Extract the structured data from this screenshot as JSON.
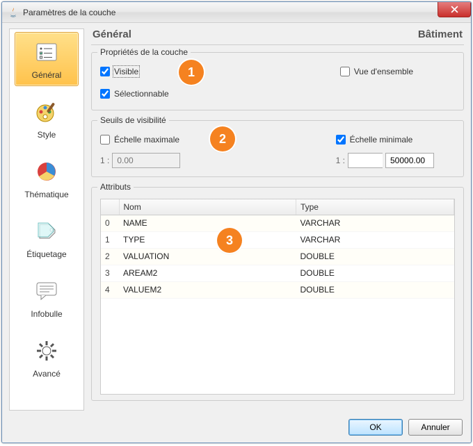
{
  "window": {
    "title": "Paramètres de la couche"
  },
  "sidebar": {
    "items": [
      {
        "label": "Général",
        "key": "general"
      },
      {
        "label": "Style",
        "key": "style"
      },
      {
        "label": "Thématique",
        "key": "theme"
      },
      {
        "label": "Étiquetage",
        "key": "label"
      },
      {
        "label": "Infobulle",
        "key": "tooltip"
      },
      {
        "label": "Avancé",
        "key": "advanced"
      }
    ]
  },
  "header": {
    "section": "Général",
    "layer_name": "Bâtiment"
  },
  "groups": {
    "props": {
      "title": "Propriétés de la couche",
      "visible": {
        "label": "Visible",
        "checked": true
      },
      "overview": {
        "label": "Vue d'ensemble",
        "checked": false
      },
      "selectable": {
        "label": "Sélectionnable",
        "checked": true
      }
    },
    "thresholds": {
      "title": "Seuils de visibilité",
      "max_scale": {
        "label": "Échelle maximale",
        "checked": false,
        "prefix": "1 :",
        "value": "0.00"
      },
      "min_scale": {
        "label": "Échelle minimale",
        "checked": true,
        "prefix": "1 :",
        "value_left": "",
        "value_right": "50000.00"
      }
    },
    "attributes": {
      "title": "Attributs",
      "columns": {
        "name": "Nom",
        "type": "Type"
      },
      "rows": [
        {
          "idx": "0",
          "name": "NAME",
          "type": "VARCHAR"
        },
        {
          "idx": "1",
          "name": "TYPE",
          "type": "VARCHAR"
        },
        {
          "idx": "2",
          "name": "VALUATION",
          "type": "DOUBLE"
        },
        {
          "idx": "3",
          "name": "AREAM2",
          "type": "DOUBLE"
        },
        {
          "idx": "4",
          "name": "VALUEM2",
          "type": "DOUBLE"
        }
      ]
    }
  },
  "buttons": {
    "ok": "OK",
    "cancel": "Annuler"
  },
  "badges": {
    "b1": "1",
    "b2": "2",
    "b3": "3"
  }
}
